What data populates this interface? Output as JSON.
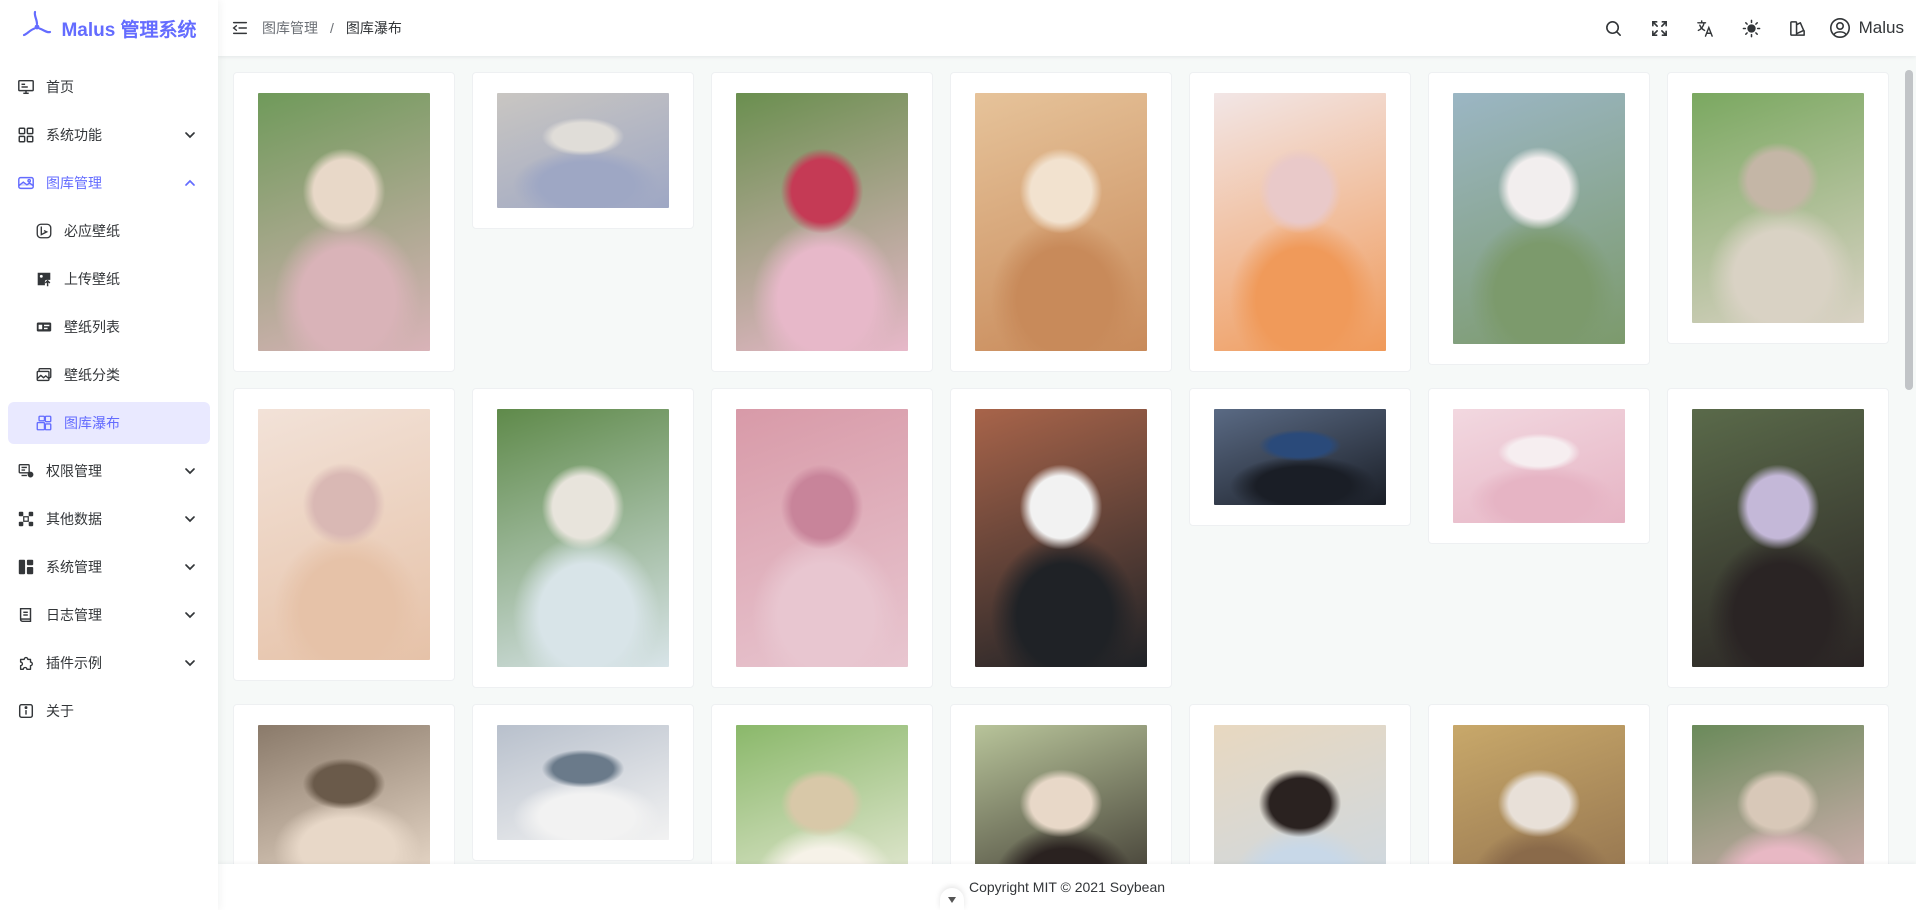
{
  "app": {
    "title": "Malus 管理系统",
    "accent": "#646cff"
  },
  "sidebar": {
    "items": [
      {
        "label": "首页",
        "icon": "desktop-icon",
        "has_children": false
      },
      {
        "label": "系统功能",
        "icon": "grid-icon",
        "has_children": true
      },
      {
        "label": "图库管理",
        "icon": "gallery-icon",
        "has_children": true,
        "open": true
      },
      {
        "label": "必应壁纸",
        "icon": "bing-icon",
        "sub": true
      },
      {
        "label": "上传壁纸",
        "icon": "upload-image-icon",
        "sub": true
      },
      {
        "label": "壁纸列表",
        "icon": "list-icon",
        "sub": true
      },
      {
        "label": "壁纸分类",
        "icon": "category-icon",
        "sub": true
      },
      {
        "label": "图库瀑布",
        "icon": "waterfall-icon",
        "sub": true,
        "active": true
      },
      {
        "label": "权限管理",
        "icon": "permission-icon",
        "has_children": true
      },
      {
        "label": "其他数据",
        "icon": "data-icon",
        "has_children": true
      },
      {
        "label": "系统管理",
        "icon": "dashboard-icon",
        "has_children": true
      },
      {
        "label": "日志管理",
        "icon": "log-icon",
        "has_children": true
      },
      {
        "label": "插件示例",
        "icon": "plugin-icon",
        "has_children": true
      },
      {
        "label": "关于",
        "icon": "info-icon",
        "has_children": false
      }
    ]
  },
  "header": {
    "breadcrumb": [
      "图库管理",
      "图库瀑布"
    ],
    "separator": "/",
    "user": "Malus",
    "icons": [
      "search-icon",
      "fullscreen-icon",
      "translate-icon",
      "theme-icon",
      "theme-config-icon"
    ]
  },
  "gallery": {
    "columns": 7,
    "photos": [
      {
        "ratio": 1.5,
        "colors": [
          "#6f9a5a",
          "#d9b3b8",
          "#e8d8c8"
        ]
      },
      {
        "ratio": 0.67,
        "colors": [
          "#c9c6c2",
          "#9ea7c4",
          "#e0ddd8"
        ]
      },
      {
        "ratio": 1.5,
        "colors": [
          "#6a8f4f",
          "#e7b8c9",
          "#c53a55"
        ]
      },
      {
        "ratio": 1.5,
        "colors": [
          "#e6c39a",
          "#c88a5a",
          "#f2e2cf"
        ]
      },
      {
        "ratio": 1.5,
        "colors": [
          "#f2e6e6",
          "#f09a5a",
          "#e9c9c9"
        ]
      },
      {
        "ratio": 1.46,
        "colors": [
          "#9bb6c4",
          "#7c9a6c",
          "#f2eeee"
        ]
      },
      {
        "ratio": 1.34,
        "colors": [
          "#7aa860",
          "#d9d2c4",
          "#c4b6a6"
        ]
      },
      {
        "ratio": 1.46,
        "colors": [
          "#f2e2d8",
          "#e6c2a8",
          "#d9b8b4"
        ]
      },
      {
        "ratio": 1.5,
        "colors": [
          "#5f8a4a",
          "#d8e4e8",
          "#e8e4dc"
        ]
      },
      {
        "ratio": 1.5,
        "colors": [
          "#d89aa8",
          "#e8c6d0",
          "#c8849a"
        ]
      },
      {
        "ratio": 1.5,
        "colors": [
          "#a8644a",
          "#1f2226",
          "#f2f2f2"
        ]
      },
      {
        "ratio": 0.56,
        "colors": [
          "#5a6a84",
          "#1a1e26",
          "#2a4a7a"
        ]
      },
      {
        "ratio": 0.66,
        "colors": [
          "#f2d8e0",
          "#e6b4c4",
          "#f6eef0"
        ]
      },
      {
        "ratio": 1.5,
        "colors": [
          "#5a6a4a",
          "#2a2424",
          "#c4b8d8"
        ]
      },
      {
        "ratio": 0.9,
        "colors": [
          "#8a7a6a",
          "#e8d8c8",
          "#6a5a4a"
        ]
      },
      {
        "ratio": 0.67,
        "colors": [
          "#b8c0cc",
          "#f2f2f2",
          "#6a7a8a"
        ]
      },
      {
        "ratio": 1.2,
        "colors": [
          "#8ab86a",
          "#f6f2e8",
          "#d8c8a8"
        ]
      },
      {
        "ratio": 1.2,
        "colors": [
          "#b8c49a",
          "#2a2220",
          "#e8d8c8"
        ]
      },
      {
        "ratio": 1.2,
        "colors": [
          "#e8d8c0",
          "#c8d8e8",
          "#2a2220"
        ]
      },
      {
        "ratio": 1.2,
        "colors": [
          "#c8a86a",
          "#8a6a4a",
          "#e8e0d8"
        ]
      },
      {
        "ratio": 1.2,
        "colors": [
          "#6a8a5a",
          "#e8b8c4",
          "#d8c8b8"
        ]
      }
    ]
  },
  "footer": {
    "text": "Copyright MIT © 2021 Soybean"
  }
}
